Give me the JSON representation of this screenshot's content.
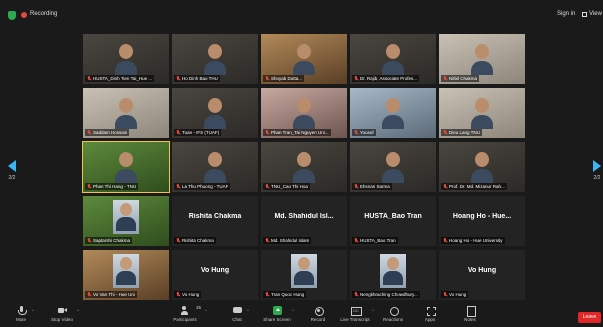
{
  "topbar": {
    "recording_label": "Recording",
    "signin_label": "Sign in",
    "view_label": "View"
  },
  "navigation": {
    "left_page": "2/2",
    "right_page": "2/2"
  },
  "tiles": [
    {
      "name": "HUSTA_Dinh Tien Tai_Hue ..."
    },
    {
      "name": "Ho Dinh Bao THU"
    },
    {
      "name": "Shoyab Dutta..."
    },
    {
      "name": "Dr. Rajib, Associate Profes..."
    },
    {
      "name": "Nitbil Chakma"
    },
    {
      "name": "Saddam Hossain"
    },
    {
      "name": "Tuan - IFS (TUAF)"
    },
    {
      "name": "Phan Tran_Tai Nguyen Uni..."
    },
    {
      "name": "Yousuf"
    },
    {
      "name": "Dieu Lang TNU"
    },
    {
      "name": "Phan Thi Hang - TNU"
    },
    {
      "name": "La Thu Phuong - TUAF"
    },
    {
      "name": "TNU_Cao Thi Hoa"
    },
    {
      "name": "Ehsnan Sarma"
    },
    {
      "name": "Prof. Dr. Md. Mizanur Rah..."
    },
    {
      "name": "Saptarshi Chakma"
    },
    {
      "name": "Rishita Chakma",
      "display": "Rishita Chakma"
    },
    {
      "name": "Md. Shahidul Islam",
      "display": "Md. Shahidul Isl..."
    },
    {
      "name": "HUSTA_Bao Tran",
      "display": "HUSTA_Bao Tran"
    },
    {
      "name": "Hoang Ho - Hue University",
      "display": "Hoang Ho - Hue..."
    },
    {
      "name": "Vo Van Thi - Hue Uni"
    },
    {
      "name": "Vo Hung",
      "display": "Vo Hung"
    },
    {
      "name": "Tran Quoc Hung"
    },
    {
      "name": "Nengkhraching Chowdhury..."
    },
    {
      "name": "Vo Hung",
      "display": "Vo Hung"
    }
  ],
  "toolbar": {
    "mute": "Mute",
    "stop_video": "Stop Video",
    "participants": "Participants",
    "participants_count": "35",
    "chat": "Chat",
    "share_screen": "Share Screen",
    "record": "Record",
    "live_transcript": "Live Transcript",
    "reactions": "Reactions",
    "apps": "Apps",
    "notes": "Notes",
    "leave": "Leave"
  },
  "colors": {
    "background": "#1a1a1a",
    "tile": "#232323",
    "accent_green": "#2fa84f",
    "leave_red": "#e02828",
    "nav_blue": "#3ab7f0",
    "speaker_outline": "#f5c542"
  }
}
